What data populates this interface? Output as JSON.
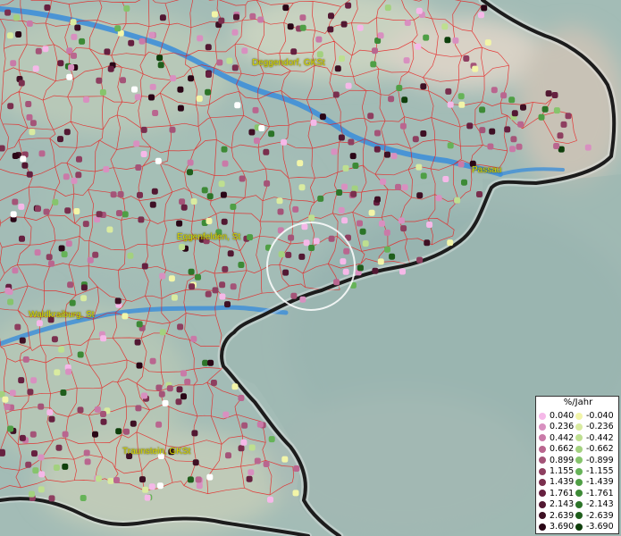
{
  "map": {
    "cities": [
      {
        "name": "Deggendorf, GKSt"
      },
      {
        "name": "Passau"
      },
      {
        "name": "Eggenfelden, St"
      },
      {
        "name": "Waldkraiburg, St"
      },
      {
        "name": "Traunstein, GKSt"
      }
    ],
    "colors": {
      "river": "#3f8fd8",
      "border": "#1c1c1c",
      "municipal_lines": "#e82020",
      "highlight_circle": "#ffffff"
    }
  },
  "legend": {
    "title": "%/Jahr",
    "positive": [
      "0.040",
      "0.236",
      "0.442",
      "0.662",
      "0.899",
      "1.155",
      "1.439",
      "1.761",
      "2.143",
      "2.639",
      "3.690"
    ],
    "negative": [
      "-0.040",
      "-0.236",
      "-0.442",
      "-0.662",
      "-0.899",
      "-1.155",
      "-1.439",
      "-1.761",
      "-2.143",
      "-2.639",
      "-3.690"
    ],
    "positive_colors": [
      "#f5b8e8",
      "#d890c0",
      "#c97aa8",
      "#b9668f",
      "#a45478",
      "#8e3f60",
      "#7a2f4e",
      "#662040",
      "#521832",
      "#3e1024",
      "#2a0616"
    ],
    "negative_colors": [
      "#f2f5a8",
      "#d9eba0",
      "#bedf90",
      "#a3d17f",
      "#86c46c",
      "#66b358",
      "#4f9f45",
      "#3d8a36",
      "#2c7428",
      "#1f5e1c",
      "#0f3f0c"
    ]
  }
}
